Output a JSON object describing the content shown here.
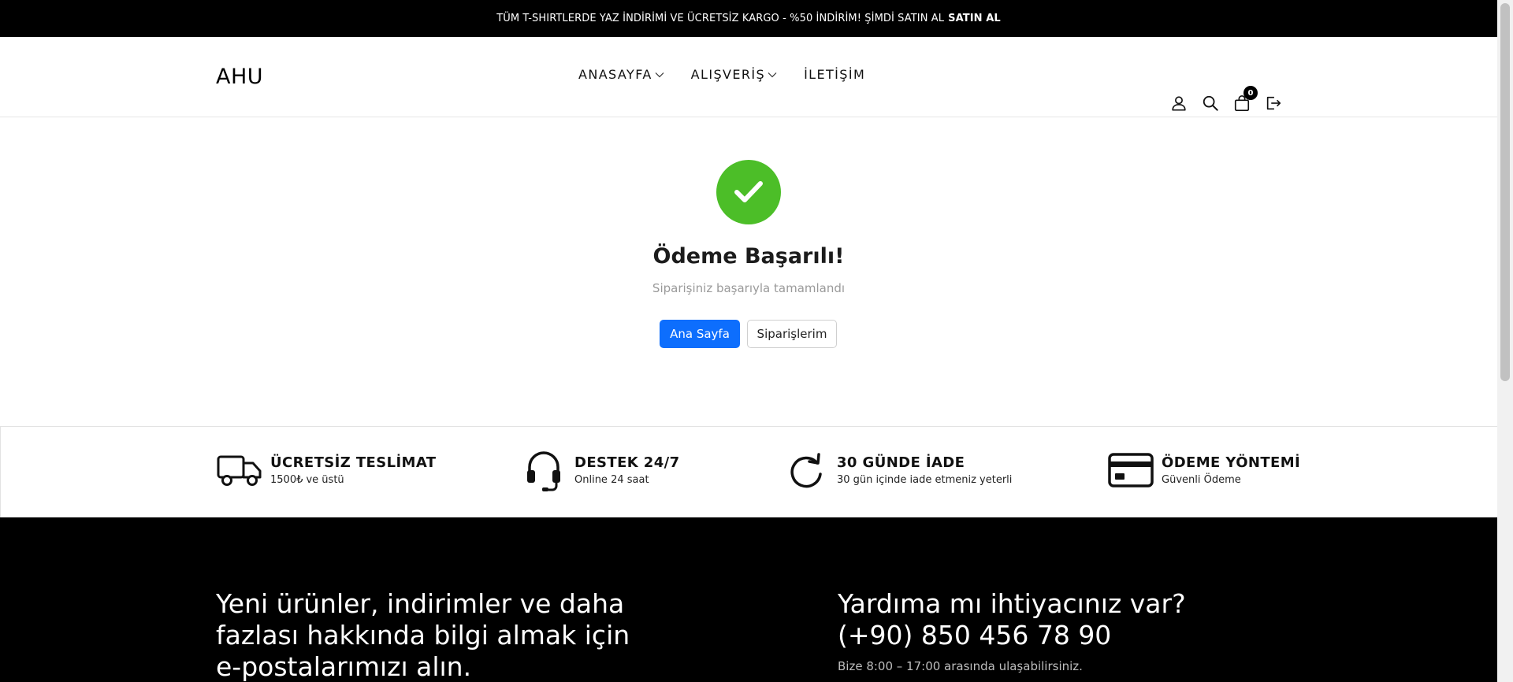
{
  "announcement": {
    "text": "TÜM T-SHIRTLERDE YAZ İNDİRİMİ VE ÜCRETSİZ KARGO - %50 İNDİRİM! ŞİMDİ SATIN AL",
    "cta": "SATIN AL"
  },
  "header": {
    "logo": "AHU",
    "nav": [
      {
        "label": "ANASAYFA",
        "has_dropdown": true
      },
      {
        "label": "ALIŞVERİŞ",
        "has_dropdown": true
      },
      {
        "label": "İLETİŞİM",
        "has_dropdown": false
      }
    ],
    "icons": [
      "user-icon",
      "search-icon",
      "cart-icon",
      "logout-icon"
    ],
    "cart_count": "0"
  },
  "success": {
    "title": "Ödeme Başarılı!",
    "subtitle": "Siparişiniz başarıyla tamamlandı",
    "primary_button": "Ana Sayfa",
    "secondary_button": "Siparişlerim",
    "check_color": "#4cbe28",
    "primary_color": "#0d6efd"
  },
  "features": [
    {
      "icon": "truck-icon",
      "title": "ÜCRETSİZ TESLİMAT",
      "subtitle": "1500₺ ve üstü"
    },
    {
      "icon": "headset-icon",
      "title": "DESTEK 24/7",
      "subtitle": "Online 24 saat"
    },
    {
      "icon": "refresh-icon",
      "title": "30 GÜNDE İADE",
      "subtitle": "30 gün içinde iade etmeniz yeterli"
    },
    {
      "icon": "credit-card-icon",
      "title": "ÖDEME YÖNTEMİ",
      "subtitle": "Güvenli Ödeme"
    }
  ],
  "footer": {
    "newsletter_heading": "Yeni ürünler, indirimler ve daha fazlası hakkında bilgi almak için e-postalarımızı alın.",
    "help_question": "Yardıma mı ihtiyacınız var?",
    "phone": "(+90) 850 456 78 90",
    "hours": "Bize 8:00 – 17:00 arasında ulaşabilirsiniz."
  }
}
